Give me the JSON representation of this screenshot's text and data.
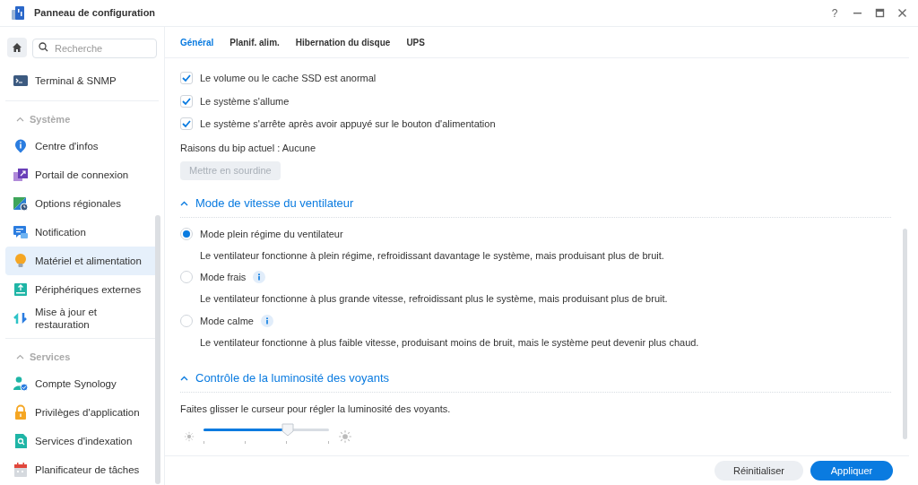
{
  "window": {
    "title": "Panneau de configuration",
    "help": "?"
  },
  "sidebar": {
    "search": {
      "placeholder": "Recherche"
    },
    "groups": [
      {
        "items": [
          {
            "label": "Terminal & SNMP",
            "selected": false
          }
        ]
      },
      {
        "title": "Système",
        "expanded": true,
        "items": [
          {
            "label": "Centre d'infos",
            "selected": false
          },
          {
            "label": "Portail de connexion",
            "selected": false
          },
          {
            "label": "Options régionales",
            "selected": false
          },
          {
            "label": "Notification",
            "selected": false
          },
          {
            "label": "Matériel et alimentation",
            "selected": true
          },
          {
            "label": "Périphériques externes",
            "selected": false
          },
          {
            "label": "Mise à jour et restauration",
            "selected": false
          }
        ]
      },
      {
        "title": "Services",
        "expanded": true,
        "items": [
          {
            "label": "Compte Synology",
            "selected": false
          },
          {
            "label": "Privilèges d'application",
            "selected": false
          },
          {
            "label": "Services d'indexation",
            "selected": false
          },
          {
            "label": "Planificateur de tâches",
            "selected": false
          }
        ]
      }
    ]
  },
  "tabs": [
    {
      "label": "Général",
      "selected": true
    },
    {
      "label": "Planif. alim.",
      "selected": false
    },
    {
      "label": "Hibernation du disque",
      "selected": false
    },
    {
      "label": "UPS",
      "selected": false
    }
  ],
  "beep_checkboxes": [
    {
      "label": "Le volume ou le cache SSD est anormal",
      "checked": true
    },
    {
      "label": "Le système s'allume",
      "checked": true
    },
    {
      "label": "Le système s'arrête après avoir appuyé sur le bouton d'alimentation",
      "checked": true
    }
  ],
  "beep_reason": "Raisons du bip actuel : Aucune",
  "mute_button": {
    "label": "Mettre en sourdine",
    "disabled": true
  },
  "fan_section": {
    "title": "Mode de vitesse du ventilateur",
    "expanded": true,
    "options": [
      {
        "label": "Mode plein régime du ventilateur",
        "selected": true,
        "info": false,
        "description": "Le ventilateur fonctionne à plein régime, refroidissant davantage le système, mais produisant plus de bruit."
      },
      {
        "label": "Mode frais",
        "selected": false,
        "info": true,
        "description": "Le ventilateur fonctionne à plus grande vitesse, refroidissant plus le système, mais produisant plus de bruit."
      },
      {
        "label": "Mode calme",
        "selected": false,
        "info": true,
        "description": "Le ventilateur fonctionne à plus faible vitesse, produisant moins de bruit, mais le système peut devenir plus chaud."
      }
    ]
  },
  "led_section": {
    "title": "Contrôle de la luminosité des voyants",
    "expanded": true,
    "hint": "Faites glisser le curseur pour régler la luminosité des voyants.",
    "slider": {
      "level": 0.67
    }
  },
  "footer": {
    "buttons": [
      {
        "label": "Réinitialiser",
        "kind": "secondary"
      },
      {
        "label": "Appliquer",
        "kind": "primary"
      }
    ]
  }
}
